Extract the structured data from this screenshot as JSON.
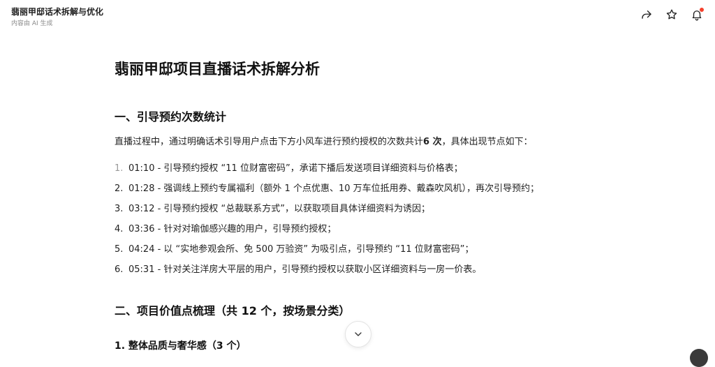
{
  "header": {
    "title": "翡丽甲邸话术拆解与优化",
    "subtitle": "内容由 AI 生成"
  },
  "icons": {
    "share": "share-icon",
    "favorite": "star-icon",
    "notification": "bell-icon",
    "scroll": "chevron-down-icon"
  },
  "colors": {
    "notification_dot": "#f5402c"
  },
  "doc": {
    "h1": "翡丽甲邸项目直播话术拆解分析",
    "section1": {
      "heading": "一、引导预约次数统计",
      "intro_prefix": "直播过程中，通过明确话术引导用户点击下方小风车进行预约授权的次数共计",
      "intro_bold": "6 次",
      "intro_suffix": "，具体出现节点如下：",
      "items": [
        {
          "num": "1.",
          "text": "01:10 - 引导预约授权 “11 位财富密码”，承诺下播后发送项目详细资料与价格表；"
        },
        {
          "num": "2.",
          "text": "01:28 - 强调线上预约专属福利（额外 1 个点优惠、10 万车位抵用券、戴森吹风机），再次引导预约；"
        },
        {
          "num": "3.",
          "text": "03:12 - 引导预约授权 “总裁联系方式”，以获取项目具体详细资料为诱因；"
        },
        {
          "num": "4.",
          "text": "03:36 - 针对对瑜伽感兴趣的用户，引导预约授权；"
        },
        {
          "num": "5.",
          "text": "04:24 - 以 “实地参观会所、免 500 万验资” 为吸引点，引导预约 “11 位财富密码”；"
        },
        {
          "num": "6.",
          "text": "05:31 - 针对关注洋房大平层的用户，引导预约授权以获取小区详细资料与一房一价表。"
        }
      ]
    },
    "section2": {
      "heading": "二、项目价值点梳理（共 12 个，按场景分类）",
      "sub1": "1. 整体品质与奢华感（3 个）"
    }
  }
}
